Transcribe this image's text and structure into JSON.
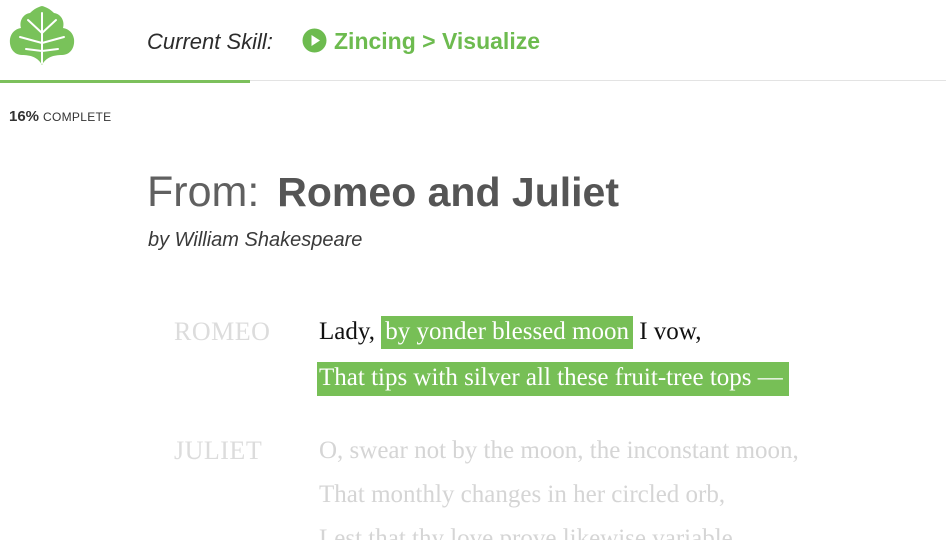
{
  "header": {
    "logo_icon": "ivy-leaf-icon",
    "skill_label": "Current Skill:",
    "skill_icon": "play-circle-icon",
    "skill_path": "Zincing > Visualize"
  },
  "progress": {
    "percent_value": 0.16,
    "percent_text": "16%",
    "label": "COMPLETE"
  },
  "title": {
    "prefix": "From:",
    "work": "Romeo and Juliet",
    "byline": "by William Shakespeare"
  },
  "passage": [
    {
      "speaker": "ROMEO",
      "lines": [
        {
          "segments": [
            {
              "text": "Lady, ",
              "highlight": false
            },
            {
              "text": "by yonder blessed moon",
              "highlight": true
            },
            {
              "text": " I vow,",
              "highlight": false
            }
          ]
        },
        {
          "segments": [
            {
              "text": "That tips with silver all these fruit-tree tops —",
              "highlight": true
            }
          ]
        }
      ]
    },
    {
      "speaker": "JULIET",
      "lines": [
        {
          "text": "O, swear not by the moon, the inconstant moon,"
        },
        {
          "text": "That monthly changes in her circled orb,"
        },
        {
          "text": "Lest that thy love prove likewise variable."
        }
      ]
    }
  ],
  "colors": {
    "accent": "#77bf56",
    "link": "#6dbb4f",
    "faded_text": "#d5d5d5"
  }
}
